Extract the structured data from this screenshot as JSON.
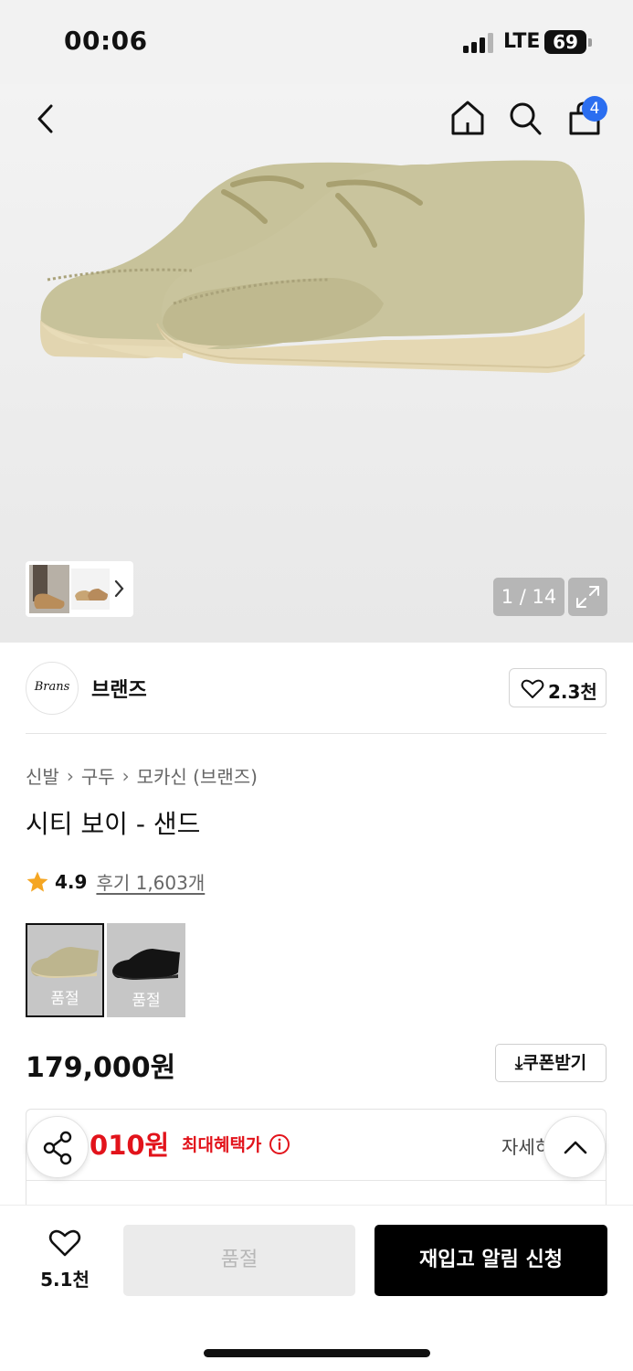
{
  "status_bar": {
    "time": "00:06",
    "network": "LTE",
    "battery": "69"
  },
  "header": {
    "cart_badge": "4"
  },
  "gallery": {
    "counter": "1 / 14"
  },
  "brand": {
    "name": "브랜즈",
    "logo_text": "Brans",
    "likes": "2.3천"
  },
  "breadcrumb": [
    "신발",
    "구두",
    "모카신 (브랜즈)"
  ],
  "product": {
    "title": "시티 보이 - 샌드",
    "rating": "4.9",
    "reviews_label": "후기 1,603개",
    "price": "179,000원",
    "coupon_label": "쿠폰받기"
  },
  "swatches": [
    {
      "label": "품절",
      "color": "sand"
    },
    {
      "label": "품절",
      "color": "black"
    }
  ],
  "benefit": {
    "price": ",010원",
    "label": "최대혜택가",
    "detail_label": "자세히"
  },
  "bottom_bar": {
    "wish_count": "5.1천",
    "soldout_label": "품절",
    "restock_label": "재입고 알림 신청"
  },
  "colors": {
    "accent_red": "#e2131b",
    "badge_blue": "#2b6ef0",
    "star": "#f5a623"
  }
}
